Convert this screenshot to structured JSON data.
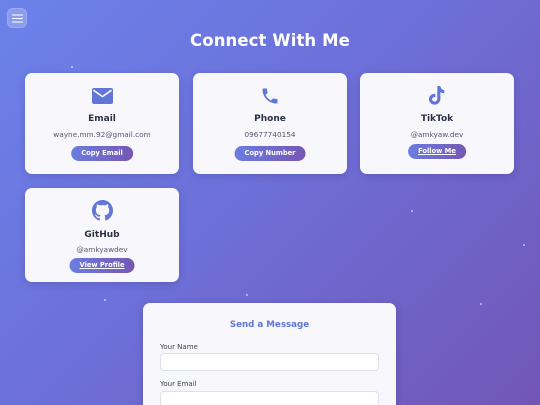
{
  "header": {
    "title": "Connect With Me",
    "menu_icon": "hamburger-menu-icon"
  },
  "contacts": [
    {
      "key": "email",
      "title": "Email",
      "value": "wayne.mm.92@gmail.com",
      "button": "Copy Email",
      "icon": "email-icon",
      "link_style": false
    },
    {
      "key": "phone",
      "title": "Phone",
      "value": "09677740154",
      "button": "Copy Number",
      "icon": "phone-icon",
      "link_style": false
    },
    {
      "key": "tiktok",
      "title": "TikTok",
      "value": "@amkyaw.dev",
      "button": "Follow Me",
      "icon": "tiktok-icon",
      "link_style": true
    },
    {
      "key": "github",
      "title": "GitHub",
      "value": "@amkyawdev",
      "button": "View Profile",
      "icon": "github-icon",
      "link_style": true
    }
  ],
  "form": {
    "title": "Send a Message",
    "fields": [
      {
        "label": "Your Name",
        "value": "",
        "placeholder": ""
      },
      {
        "label": "Your Email",
        "value": "",
        "placeholder": ""
      }
    ]
  },
  "colors": {
    "background_start": "#6b82ea",
    "background_end": "#7256b6",
    "accent": "#6276d8",
    "button_gradient_start": "#6b7de1",
    "button_gradient_end": "#7657b3",
    "card": "#f7f7fc"
  }
}
